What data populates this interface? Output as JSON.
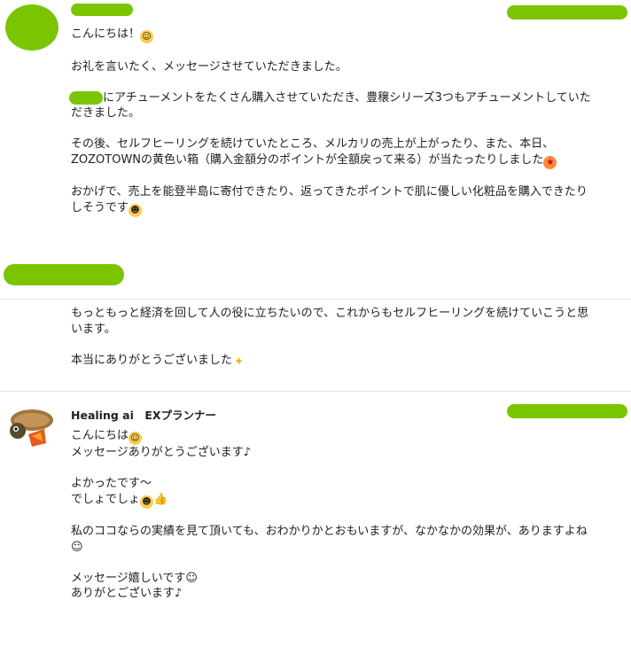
{
  "msg1": {
    "p1": [
      "こんにちは！"
    ],
    "p2": [
      "お礼を言いたく、メッセージさせていただきました。"
    ],
    "p3": [
      "にアチューメントをたくさん購入させていただき、豊穣シリーズ3つもアチューメントしていた",
      "だきました。"
    ],
    "p4": [
      "その後、セルフヒーリングを続けていたところ、メルカリの売上が上がったり、また、本日、",
      "ZOZOTOWNの黄色い箱（購入金額分のポイントが全額戻って来る）が当たったりしました"
    ],
    "p5": [
      "おかげで、売上を能登半島に寄付できたり、返ってきたポイントで肌に優しい化粧品を購入できたり",
      "しそうです"
    ]
  },
  "msg2": {
    "p1": [
      "もっともっと経済を回して人の役に立ちたいので、これからもセルフヒーリングを続けていこうと思",
      "います。"
    ],
    "p2": [
      "本当にありがとうございました"
    ]
  },
  "msg3": {
    "sender": "Healing ai　EXプランナー",
    "p1": [
      "こんにちは",
      "メッセージありがとうございます♪"
    ],
    "p2": [
      "よかったです～",
      "でしょでしょ"
    ],
    "p3": [
      "私のココならの実績を見て頂いても、おわかりかとおもいますが、なかなかの効果が、ありますよね",
      "☺"
    ],
    "p4": [
      "メッセージ嬉しいです☺",
      "ありがとございます♪"
    ]
  },
  "emoji": {
    "smile": "smiling-face-emoji",
    "star_eyes": "star-struck-emoji",
    "laugh": "grinning-squint-emoji",
    "sparkles": "sparkles-emoji",
    "thumbs": "thumbs-up-emoji"
  },
  "colors": {
    "redaction": "#7bc400",
    "divider": "#e4e4e4"
  }
}
